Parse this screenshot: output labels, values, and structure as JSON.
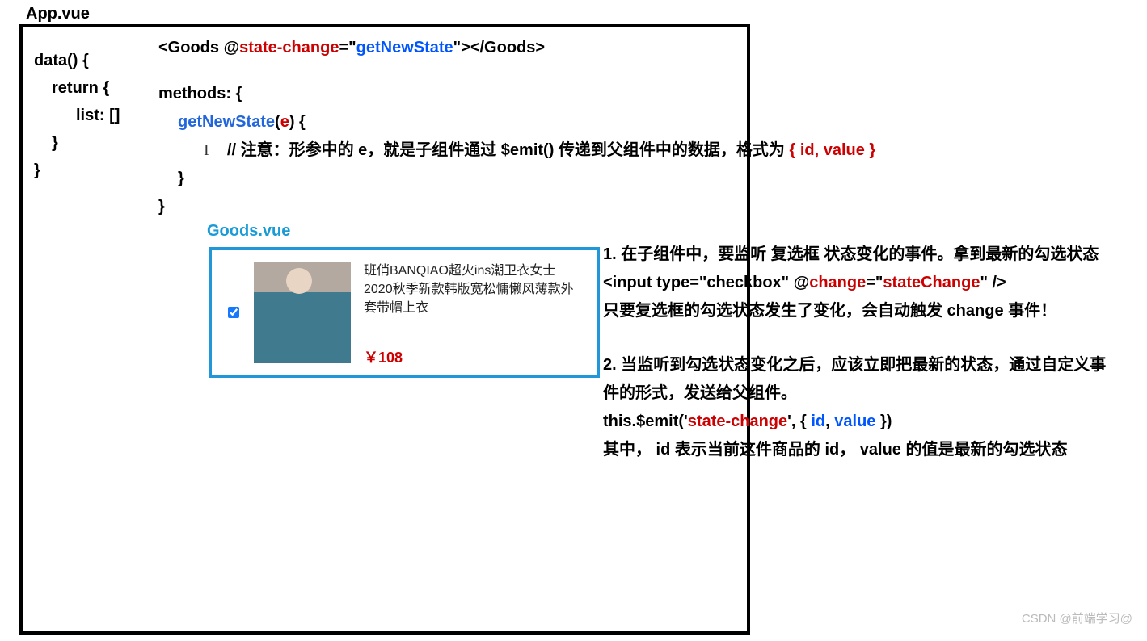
{
  "app_label": "App.vue",
  "code_left": {
    "l1": "data() {",
    "l2": "return {",
    "l3": "list: []",
    "l4": "}",
    "l5": "}"
  },
  "goods_tag": {
    "open1": "<Goods @",
    "event": "state-change",
    "mid": "=\"",
    "handler": "getNewState",
    "close": "\"></Goods>"
  },
  "methods": {
    "head": "methods: {",
    "fn_name": "getNewState",
    "fn_open": "(",
    "fn_param": "e",
    "fn_close": ") {",
    "comment_pre": "// 注意：形参中的 e，就是子组件通过 $emit() 传递到父组件中的数据，格式为 ",
    "comment_obj": "{ id, value }",
    "brace1": "}",
    "brace2": "}"
  },
  "goods_label": "Goods.vue",
  "product": {
    "title": "班俏BANQIAO超火ins潮卫衣女士2020秋季新款韩版宽松慵懒风薄款外套带帽上衣",
    "price": "￥108"
  },
  "explain": {
    "p1": "1. 在子组件中，要监听 复选框 状态变化的事件。拿到最新的勾选状态",
    "input_pre": "<input type=\"checkbox\" @",
    "input_change": "change",
    "input_mid": "=\"",
    "input_handler": "stateChange",
    "input_close": "\" />",
    "p2": "只要复选框的勾选状态发生了变化，会自动触发 change 事件！",
    "p3": "2. 当监听到勾选状态变化之后，应该立即把最新的状态，通过自定义事件的形式，发送给父组件。",
    "emit_pre": "this.$emit('",
    "emit_event": "state-change",
    "emit_mid": "', { ",
    "emit_id": "id",
    "emit_sep": ", ",
    "emit_value": "value",
    "emit_close": " })",
    "p4": "其中， id 表示当前这件商品的 id， value 的值是最新的勾选状态"
  },
  "watermark": "CSDN @前端学习@"
}
